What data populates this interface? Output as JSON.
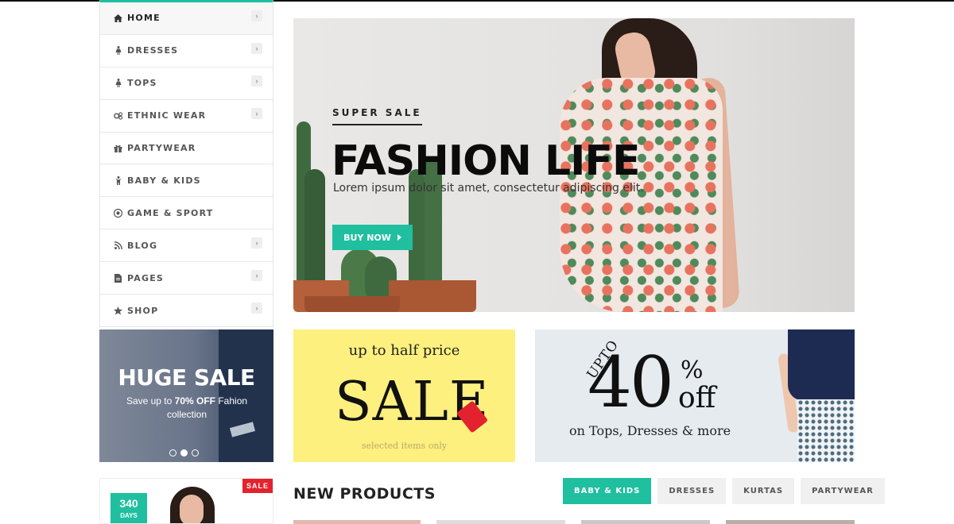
{
  "sidebar": {
    "items": [
      {
        "label": "HOME",
        "icon": "home-icon",
        "has_submenu": true
      },
      {
        "label": "DRESSES",
        "icon": "female-icon",
        "has_submenu": true
      },
      {
        "label": "TOPS",
        "icon": "female-icon",
        "has_submenu": true
      },
      {
        "label": "ETHNIC WEAR",
        "icon": "gears-icon",
        "has_submenu": true
      },
      {
        "label": "PARTYWEAR",
        "icon": "gift-icon",
        "has_submenu": false
      },
      {
        "label": "BABY & KIDS",
        "icon": "child-icon",
        "has_submenu": false
      },
      {
        "label": "GAME & SPORT",
        "icon": "soccer-ball-icon",
        "has_submenu": false
      },
      {
        "label": "BLOG",
        "icon": "rss-icon",
        "has_submenu": true
      },
      {
        "label": "PAGES",
        "icon": "file-icon",
        "has_submenu": true
      },
      {
        "label": "SHOP",
        "icon": "star-icon",
        "has_submenu": true
      }
    ]
  },
  "hero": {
    "kicker": "SUPER SALE",
    "title": "FASHION LIFE",
    "subtitle": "Lorem ipsum dolor sit amet, consectetur adipiscing elit.",
    "button_label": "BUY NOW"
  },
  "promo_left": {
    "title": "HUGE SALE",
    "sub_prefix": "Save up to ",
    "sub_bold": "70% OFF",
    "sub_suffix": " Fahion collection",
    "slide_count": 3,
    "active_slide": 2
  },
  "promo_yellow": {
    "line1": "up to half price",
    "big": "SALE",
    "footer": "selected items only"
  },
  "promo_blue": {
    "upto": "UPTO",
    "number": "40",
    "percent": "%",
    "off": "off",
    "line": "on Tops, Dresses & more"
  },
  "deal": {
    "days_number": "340",
    "days_label": "DAYS",
    "badge": "SALE"
  },
  "products": {
    "heading": "NEW PRODUCTS",
    "tabs": [
      "BABY & KIDS",
      "DRESSES",
      "KURTAS",
      "PARTYWEAR"
    ],
    "active_tab": 0
  },
  "colors": {
    "accent": "#1fbf9f",
    "sale_red": "#e3222e",
    "yellow": "#fdf07e"
  }
}
